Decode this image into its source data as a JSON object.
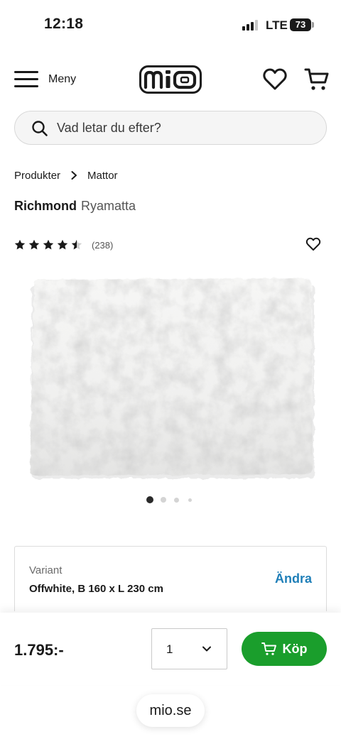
{
  "status_bar": {
    "time": "12:18",
    "network": "LTE",
    "battery": "73"
  },
  "header": {
    "menu_label": "Meny",
    "logo_text": "mio"
  },
  "search": {
    "placeholder": "Vad letar du efter?"
  },
  "breadcrumb": [
    "Produkter",
    "Mattor"
  ],
  "product": {
    "brand": "Richmond",
    "type": "Ryamatta",
    "rating": 4.5,
    "review_count": "(238)",
    "image_count": 4,
    "active_image": 1
  },
  "variant": {
    "label": "Variant",
    "value": "Offwhite, B 160 x L 230 cm",
    "change_label": "Ändra"
  },
  "purchase": {
    "price": "1.795:-",
    "quantity": "1",
    "buy_label": "Köp"
  },
  "browser": {
    "url": "mio.se"
  },
  "colors": {
    "buy_green": "#1a9e2c",
    "link_blue": "#1f7fb8",
    "text": "#1a1a1a"
  }
}
